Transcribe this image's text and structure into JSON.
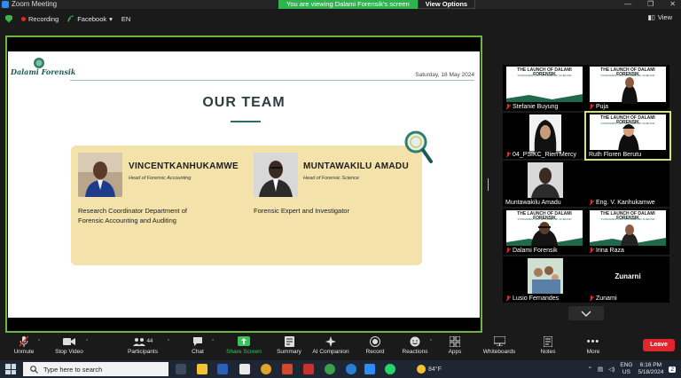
{
  "window": {
    "title": "Zoom Meeting",
    "controls": [
      "—",
      "❐",
      "✕"
    ]
  },
  "banner": {
    "message": "You are viewing Dalami Forensik's screen",
    "view_options": "View Options"
  },
  "top_toolbar": {
    "recording": "Recording",
    "facebook": "Facebook",
    "language": "EN",
    "view": "View"
  },
  "slide": {
    "logo_text": "Dalami Forensik",
    "date": "Saturday, 18 May 2024",
    "heading": "OUR TEAM",
    "members": [
      {
        "name": "VINCENTKANHUKAMWE",
        "role": "Head of Forensic Accounting",
        "description_line1": "Research Coordinator Department of",
        "description_line2": "Forensic Accounting and Auditing"
      },
      {
        "name": "MUNTAWAKILU AMADU",
        "role": "Head of Forensic Science",
        "description_line1": "Forensic Expert and Investigator",
        "description_line2": ""
      }
    ]
  },
  "gallery": {
    "mini_title": "THE LAUNCH OF DALAMI FORENSIK",
    "mini_subtitle": "\"FUNDAMENTALS OF FORENSIC SCIENCE\"",
    "participants": [
      {
        "name": "Stefanie Buyung"
      },
      {
        "name": "Puja"
      },
      {
        "name": "04_PSIKC_Rien Mercy"
      },
      {
        "name": "Ruth Floren Berutu"
      },
      {
        "name": "Muntawakilu Amadu"
      },
      {
        "name": "Eng. V. Kanhukamwe"
      },
      {
        "name": "Dalami Forensik"
      },
      {
        "name": "Irina Raza"
      },
      {
        "name": "Lusio Fernandes"
      },
      {
        "name": "Zunarni",
        "avatar_text": "Zunarni"
      }
    ]
  },
  "controls": {
    "unmute": "Unmute",
    "stop_video": "Stop Video",
    "participants": "Participants",
    "participants_count": "44",
    "chat": "Chat",
    "share_screen": "Share Screen",
    "summary": "Summary",
    "ai_companion": "AI Companion",
    "record": "Record",
    "reactions": "Reactions",
    "apps": "Apps",
    "whiteboards": "Whiteboards",
    "notes": "Notes",
    "more": "More",
    "leave": "Leave"
  },
  "taskbar": {
    "search_placeholder": "Type here to search",
    "temperature": "84°F",
    "lang_top": "ENG",
    "lang_bottom": "US",
    "time": "6:16 PM",
    "date": "5/18/2024",
    "notifications": "2"
  },
  "colors": {
    "accent_green": "#6fb43f",
    "banner_green": "#2fb34f",
    "leave_red": "#e0252f",
    "card_yellow": "#f3e2aa"
  }
}
